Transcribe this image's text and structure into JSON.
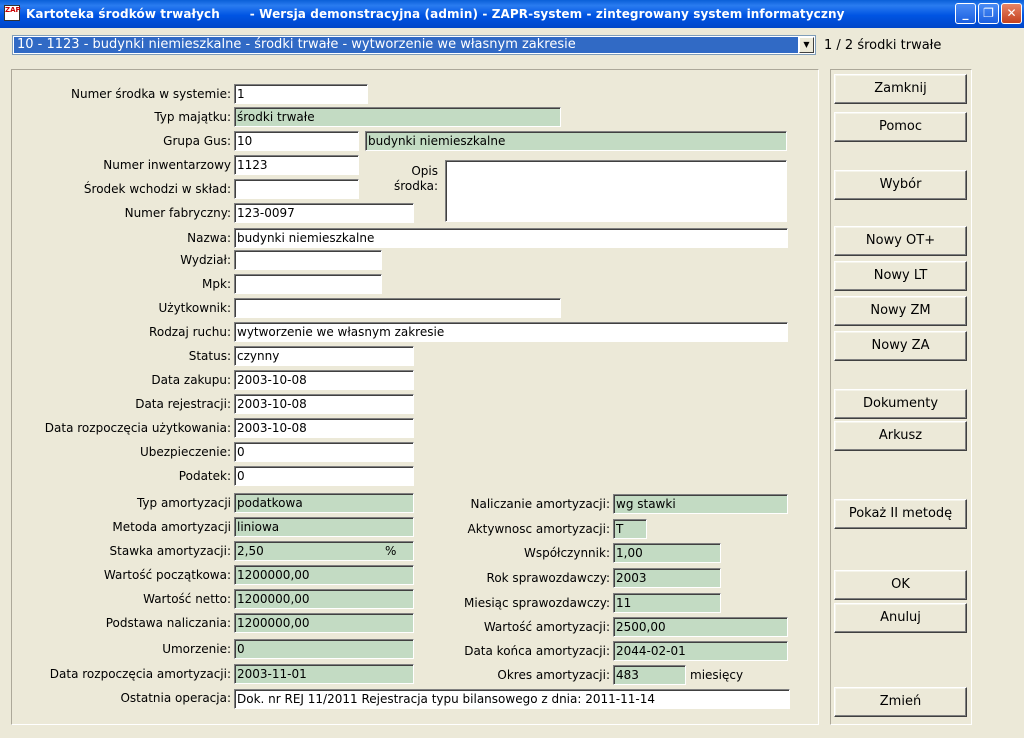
{
  "titlebar": {
    "title": "Kartoteka środków trwałych       - Wersja demonstracyjna (admin) - ZAPR-system - zintegrowany system informatyczny",
    "app_icon": "ZAP"
  },
  "record_selector": {
    "value": "10 - 1123 - budynki niemieszkalne - środki trwałe - wytworzenie we własnym zakresie",
    "counter": "1 / 2 środki trwałe"
  },
  "form": {
    "numer_srodka": {
      "label": "Numer środka w systemie:",
      "value": "1"
    },
    "typ_majatku": {
      "label": "Typ majątku:",
      "value": "środki trwałe"
    },
    "grupa_gus": {
      "label": "Grupa Gus:",
      "value": "10",
      "name": "budynki niemieszkalne"
    },
    "numer_inwentarzowy": {
      "label": "Numer inwentarzowy",
      "value": "1123"
    },
    "srodek_wchodzi": {
      "label": "Środek wchodzi w skład:",
      "value": ""
    },
    "opis_srodka": {
      "label_line1": "Opis",
      "label_line2": "środka:",
      "value": ""
    },
    "numer_fabryczny": {
      "label": "Numer fabryczny:",
      "value": "123-0097"
    },
    "nazwa": {
      "label": "Nazwa:",
      "value": "budynki niemieszkalne"
    },
    "wydzial": {
      "label": "Wydział:",
      "value": ""
    },
    "mpk": {
      "label": "Mpk:",
      "value": ""
    },
    "uzytkownik": {
      "label": "Użytkownik:",
      "value": ""
    },
    "rodzaj_ruchu": {
      "label": "Rodzaj ruchu:",
      "value": "wytworzenie we własnym zakresie"
    },
    "status": {
      "label": "Status:",
      "value": "czynny"
    },
    "data_zakupu": {
      "label": "Data zakupu:",
      "value": "2003-10-08"
    },
    "data_rejestracji": {
      "label": "Data rejestracji:",
      "value": "2003-10-08"
    },
    "data_rozpoczecia_uzytkowania": {
      "label": "Data rozpoczęcia użytkowania:",
      "value": "2003-10-08"
    },
    "ubezpieczenie": {
      "label": "Ubezpieczenie:",
      "value": "0"
    },
    "podatek": {
      "label": "Podatek:",
      "value": "0"
    },
    "typ_amortyzacji": {
      "label": "Typ amortyzacji",
      "value": "podatkowa"
    },
    "metoda_amortyzacji": {
      "label": "Metoda amortyzacji",
      "value": "liniowa"
    },
    "stawka_amortyzacji": {
      "label": "Stawka amortyzacji:",
      "value": "2,50",
      "unit": "%"
    },
    "wartosc_poczatkowa": {
      "label": "Wartość początkowa:",
      "value": "1200000,00"
    },
    "wartosc_netto": {
      "label": "Wartość netto:",
      "value": "1200000,00"
    },
    "podstawa_naliczania": {
      "label": "Podstawa naliczania:",
      "value": "1200000,00"
    },
    "umorzenie": {
      "label": "Umorzenie:",
      "value": "0"
    },
    "data_rozpoczecia_amortyzacji": {
      "label": "Data rozpoczęcia amortyzacji:",
      "value": "2003-11-01"
    },
    "naliczanie_amortyzacji": {
      "label": "Naliczanie amortyzacji:",
      "value": "wg stawki"
    },
    "aktywnosc_amortyzacji": {
      "label": "Aktywnosc amortyzacji:",
      "value": "T"
    },
    "wspolczynnik": {
      "label": "Współczynnik:",
      "value": "1,00"
    },
    "rok_sprawozdawczy": {
      "label": "Rok sprawozdawczy:",
      "value": "2003"
    },
    "miesiac_sprawozdawczy": {
      "label": "Miesiąc sprawozdawczy:",
      "value": "11"
    },
    "wartosc_amortyzacji": {
      "label": "Wartość amortyzacji:",
      "value": "2500,00"
    },
    "data_konca_amortyzacji": {
      "label": "Data końca amortyzacji:",
      "value": "2044-02-01"
    },
    "okres_amortyzacji": {
      "label": "Okres amortyzacji:",
      "value": "483",
      "unit": "miesięcy"
    },
    "ostatnia_operacja": {
      "label": "Ostatnia operacja:",
      "value": "Dok. nr REJ 11/2011 Rejestracja typu bilansowego z dnia: 2011-11-14"
    }
  },
  "buttons": {
    "zamknij": "Zamknij",
    "pomoc": "Pomoc",
    "wybor": "Wybór",
    "nowy_ot": "Nowy OT+",
    "nowy_lt": "Nowy LT",
    "nowy_zm": "Nowy ZM",
    "nowy_za": "Nowy ZA",
    "dokumenty": "Dokumenty",
    "arkusz": "Arkusz",
    "pokaz_ii_metode": "Pokaż II metodę",
    "ok": "OK",
    "anuluj": "Anuluj",
    "zmien": "Zmień"
  },
  "colors": {
    "titlebar": "#0054e3",
    "window_bg": "#ece9d8",
    "readonly_field": "#c3dbc3",
    "selection": "#316ac5"
  }
}
